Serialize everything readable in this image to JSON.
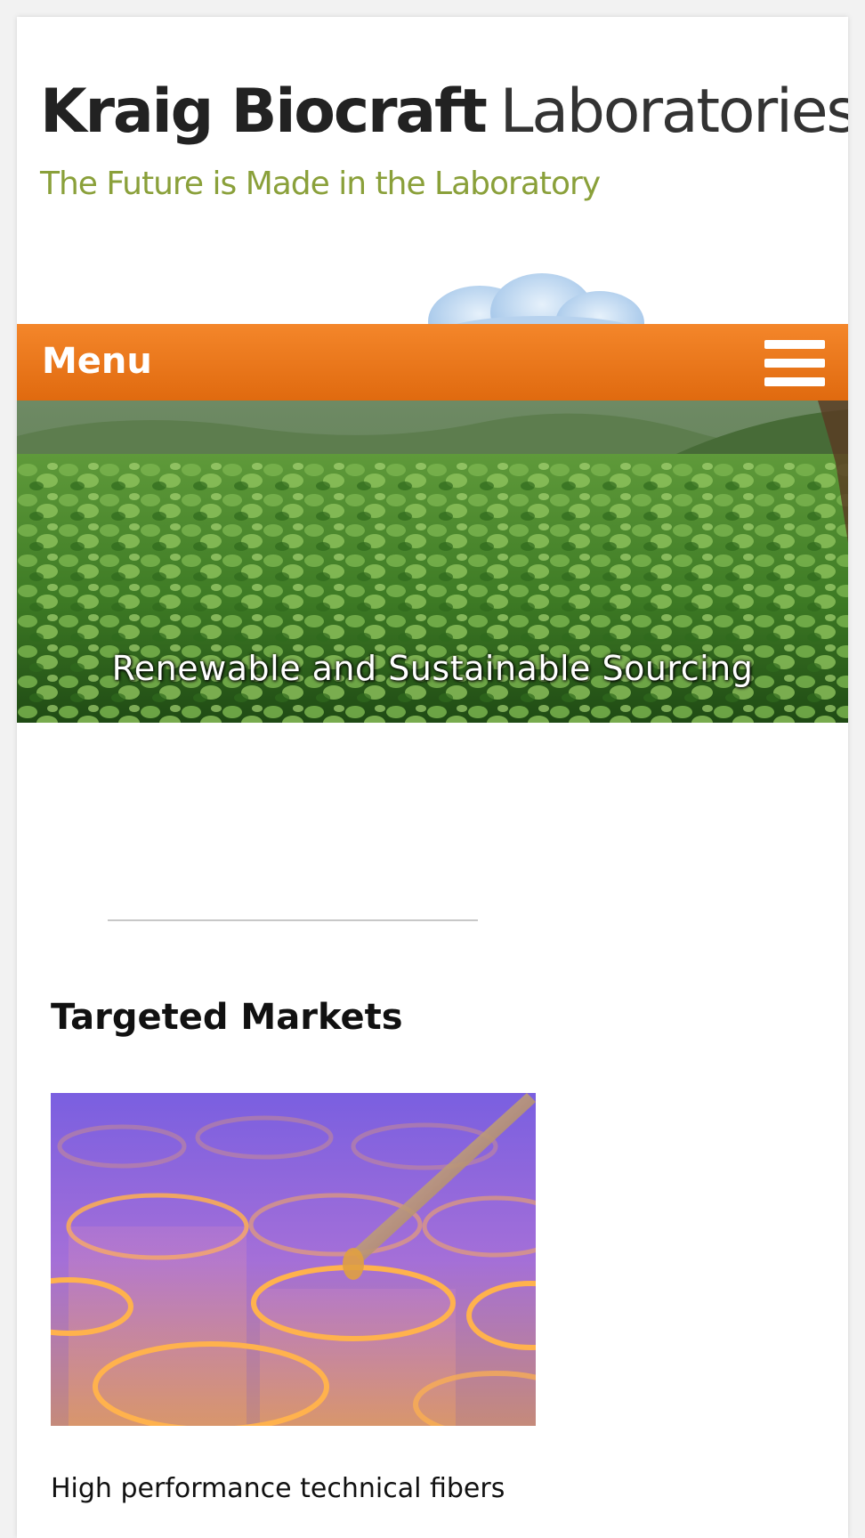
{
  "header": {
    "logo_bold": "Kraig Biocraft",
    "logo_light": "Laboratories",
    "tagline": "The Future is Made in the Laboratory"
  },
  "menu": {
    "label": "Menu",
    "icon": "hamburger-icon"
  },
  "hero": {
    "caption": "Renewable and Sustainable Sourcing"
  },
  "content": {
    "section_title": "Targeted Markets",
    "image_subject": "pipette-test-tubes",
    "paragraph_start": "High performance technical fibers"
  },
  "colors": {
    "menu_bar": "#ef7a1d",
    "tagline_green": "#8aa03a",
    "page_background": "#f2f2f2"
  }
}
